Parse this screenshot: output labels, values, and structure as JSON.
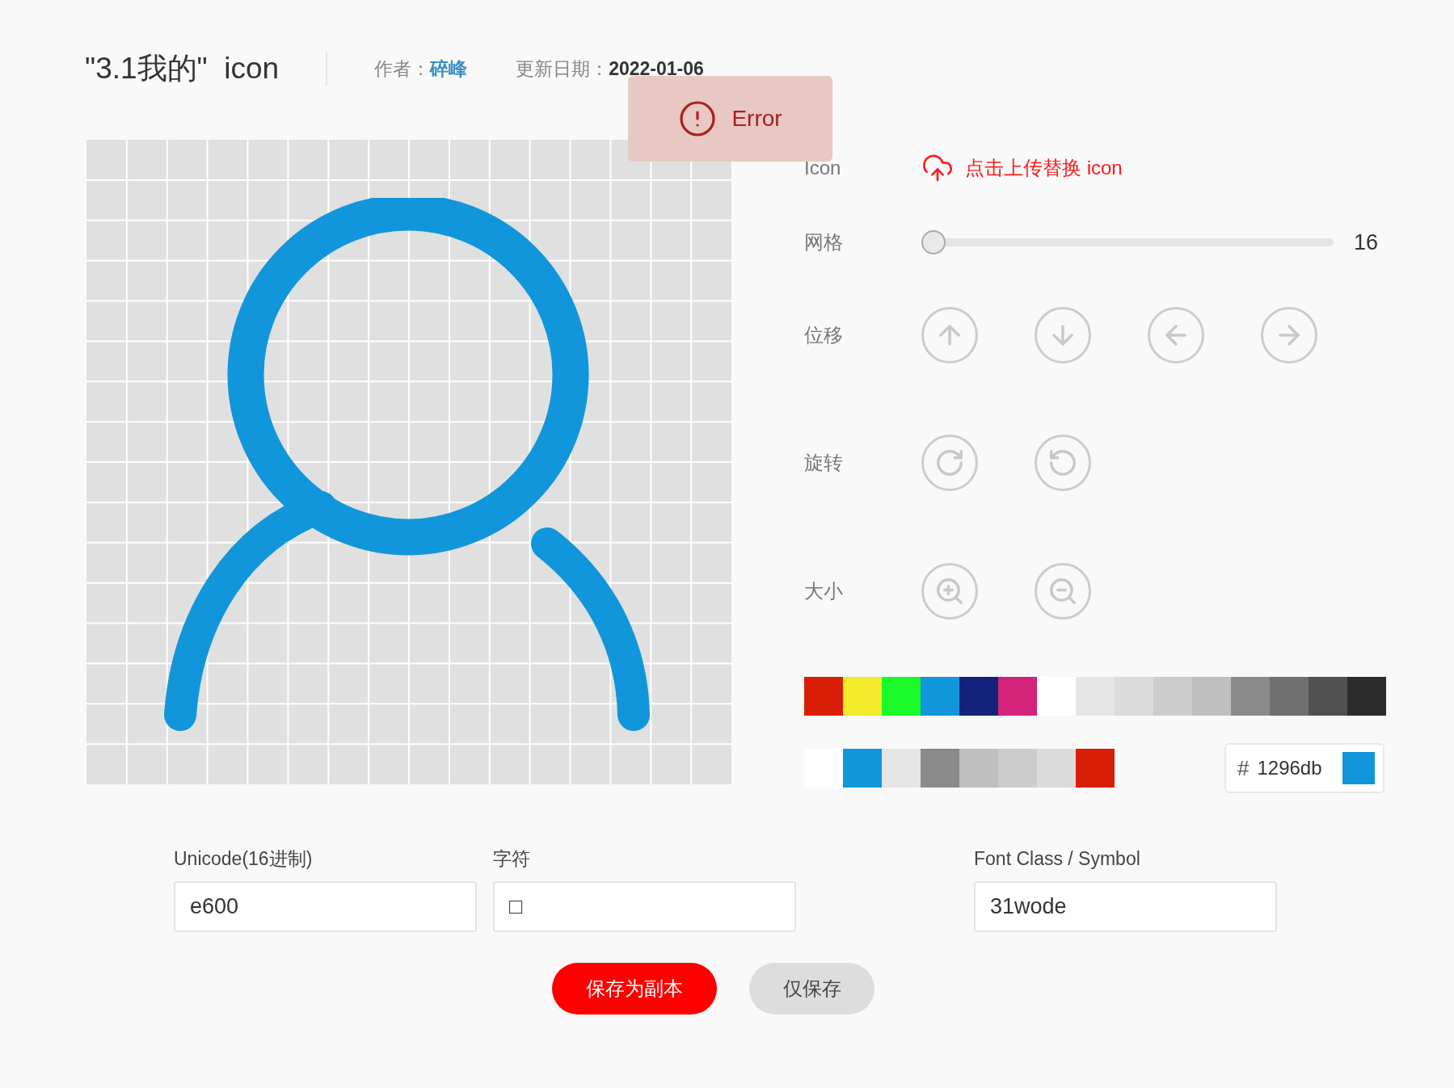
{
  "header": {
    "title": "\"3.1我的\"  icon",
    "author_label": "作者：",
    "author": "碎峰",
    "date_label": "更新日期：",
    "date": "2022-01-06"
  },
  "toast": {
    "kind": "error",
    "text": "Error"
  },
  "controls": {
    "upload": {
      "label": "Icon",
      "action": "点击上传替换 icon"
    },
    "grid": {
      "label": "网格",
      "level": 0,
      "reading": "16"
    },
    "move": {
      "label": "位移",
      "buttons": [
        {
          "kind": "up"
        },
        {
          "kind": "down"
        },
        {
          "kind": "left"
        },
        {
          "kind": "right"
        }
      ]
    },
    "rotate": {
      "label": "旋转",
      "buttons": [
        {
          "kind": "cw"
        },
        {
          "kind": "ccw"
        }
      ]
    },
    "size": {
      "label": "大小",
      "buttons": [
        {
          "kind": "zoom_in"
        },
        {
          "kind": "zoom_out"
        }
      ]
    }
  },
  "palette": [
    {
      "color": "#d81e06"
    },
    {
      "color": "#f4ea2a"
    },
    {
      "color": "#1afa29"
    },
    {
      "color": "#1296db"
    },
    {
      "color": "#13227a"
    },
    {
      "color": "#d4237a"
    },
    {
      "color": "#ffffff"
    },
    {
      "color": "#e6e6e6"
    },
    {
      "color": "#dbdbdb"
    },
    {
      "color": "#cdcdcd"
    },
    {
      "color": "#bfbfbf"
    },
    {
      "color": "#8a8a8a"
    },
    {
      "color": "#707070"
    },
    {
      "color": "#515151"
    },
    {
      "color": "#2c2c2c"
    }
  ],
  "recent_colors": [
    {
      "color": "#ffffff"
    },
    {
      "color": "#1296db"
    },
    {
      "color": "#e6e6e6"
    },
    {
      "color": "#8a8a8a"
    },
    {
      "color": "#bfbfbf"
    },
    {
      "color": "#cdcdcd"
    },
    {
      "color": "#dbdbdb"
    },
    {
      "color": "#d81e06"
    }
  ],
  "color_input": {
    "prefix": "#",
    "value": "1296db",
    "color": "#1296db"
  },
  "fields": [
    {
      "label": "Unicode(16进制)",
      "value": "e600"
    },
    {
      "label": "字符",
      "value": "□"
    },
    {
      "label": "Font Class / Symbol",
      "value": "31wode"
    }
  ],
  "buttons": [
    {
      "label": "保存为副本",
      "kind": "primary"
    },
    {
      "label": "仅保存",
      "kind": "secondary"
    }
  ]
}
